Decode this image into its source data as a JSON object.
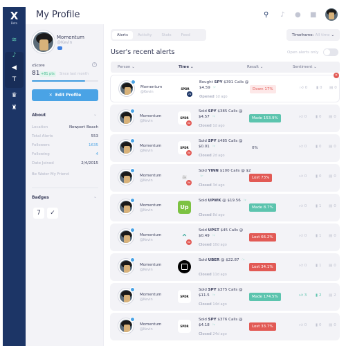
{
  "app": {
    "logo_text": "X",
    "logo_badge": "Beta"
  },
  "nav": {
    "items": [
      {
        "name": "signal-icon",
        "glyph": "≋"
      },
      {
        "name": "alerts-bell-icon",
        "glyph": "♪"
      },
      {
        "name": "megaphone-icon",
        "glyph": "◀"
      },
      {
        "name": "filter-icon",
        "glyph": "T"
      },
      {
        "name": "trophy-icon",
        "glyph": "♛"
      },
      {
        "name": "graduation-icon",
        "glyph": "♜"
      }
    ]
  },
  "page": {
    "title": "My Profile"
  },
  "profile": {
    "name": "Momentum",
    "handle": "@Kevin",
    "xscore_label": "xScore",
    "xscore_value": "81",
    "xscore_delta": "+81 pts",
    "xscore_since": "Since last month",
    "xscore_progress_percent": 80,
    "edit_button": "Edit Profile",
    "about_label": "About",
    "about": [
      {
        "key": "Location",
        "value": "Newport Beach",
        "link": false
      },
      {
        "key": "Total Alerts",
        "value": "553",
        "link": false
      },
      {
        "key": "Followers",
        "value": "1635",
        "link": true
      },
      {
        "key": "Following",
        "value": "4",
        "link": true
      },
      {
        "key": "Date Joined",
        "value": "2/4/2015",
        "link": false
      }
    ],
    "bio": "Be Water My Friend",
    "badges_label": "Badges",
    "badges": [
      "7",
      "✓"
    ]
  },
  "topbar": {
    "icons": [
      "search-icon",
      "bell-icon",
      "chat-icon",
      "discord-icon",
      "avatar"
    ]
  },
  "tabs": [
    {
      "label": "Alerts",
      "active": true
    },
    {
      "label": "Activity",
      "active": false
    },
    {
      "label": "Stats",
      "active": false
    },
    {
      "label": "Feed",
      "active": false
    }
  ],
  "timeframe": {
    "label": "Timeframe:",
    "value": "All time"
  },
  "alerts": {
    "title": "User's recent alerts",
    "open_only_label": "Open alerts only",
    "open_only_on": false,
    "columns": [
      "Person",
      "Time",
      "Result",
      "Sentiment"
    ],
    "rows": [
      {
        "name": "Momentum",
        "handle": "@Kevin",
        "logo": "SPDR",
        "logo_type": "spdr",
        "dte": "7d",
        "dte_color": "#1c3566",
        "action": "Bought",
        "ticker": "SPY",
        "rest": "$391 Calls @ $4.59",
        "status_label": "Opened",
        "status_time": "1d ago",
        "result": "Down 17%",
        "result_type": "down",
        "likes": "0",
        "bookmarks": "0",
        "comments": "0",
        "highlight": false,
        "first": true
      },
      {
        "name": "Momentum",
        "handle": "@Kevin",
        "logo": "SPDR",
        "logo_type": "spdr",
        "dte": "0d",
        "dte_color": "#e25a55",
        "action": "Sold",
        "ticker": "SPY",
        "rest": "$385 Calls @ $4.57",
        "status_label": "Closed",
        "status_time": "1d ago",
        "result": "Made 153.9%",
        "result_type": "made",
        "likes": "0",
        "bookmarks": "0",
        "comments": "0",
        "highlight": false,
        "first": false
      },
      {
        "name": "Momentum",
        "handle": "@Kevin",
        "logo": "SPDR",
        "logo_type": "spdr",
        "dte": "0d",
        "dte_color": "#e25a55",
        "action": "Sold",
        "ticker": "SPY",
        "rest": "$485 Calls @ $0.01",
        "status_label": "Closed",
        "status_time": "2d ago",
        "result": "0%",
        "result_type": "zero",
        "likes": "0",
        "bookmarks": "0",
        "comments": "0",
        "highlight": false,
        "first": false
      },
      {
        "name": "Momentum",
        "handle": "@Kevin",
        "logo": "≋",
        "logo_type": "waves",
        "dte": "0d",
        "dte_color": "#e25a55",
        "action": "Sold",
        "ticker": "YINN",
        "rest": "$100 Calls @ $2",
        "status_label": "Closed",
        "status_time": "3d ago",
        "result": "Lost 73%",
        "result_type": "lost",
        "likes": "0",
        "bookmarks": "0",
        "comments": "0",
        "highlight": false,
        "first": false
      },
      {
        "name": "Momentum",
        "handle": "@Kevin",
        "logo": "Up",
        "logo_type": "up",
        "dte": "",
        "dte_color": "",
        "action": "Sold",
        "ticker": "UPWK",
        "rest": "@ $19.56",
        "status_label": "Closed",
        "status_time": "8d ago",
        "result": "Made 8.7%",
        "result_type": "made",
        "likes": "0",
        "bookmarks": "1",
        "comments": "0",
        "highlight": false,
        "first": false
      },
      {
        "name": "Momentum",
        "handle": "@Kevin",
        "logo": "⌃",
        "logo_type": "upst",
        "dte": "0d",
        "dte_color": "#e25a55",
        "action": "Sold",
        "ticker": "UPST",
        "rest": "$45 Calls @ $0.49",
        "status_label": "Closed",
        "status_time": "10d ago",
        "result": "Lost 66.2%",
        "result_type": "lost",
        "likes": "0",
        "bookmarks": "1",
        "comments": "0",
        "highlight": false,
        "first": false
      },
      {
        "name": "Momentum",
        "handle": "@Kevin",
        "logo": "",
        "logo_type": "uber",
        "dte": "",
        "dte_color": "",
        "action": "Sold",
        "ticker": "UBER",
        "rest": "@ $22.87",
        "status_label": "Closed",
        "status_time": "11d ago",
        "result": "Lost 34.1%",
        "result_type": "lost",
        "likes": "0",
        "bookmarks": "1",
        "comments": "0",
        "highlight": false,
        "first": false
      },
      {
        "name": "Momentum",
        "handle": "@Kevin",
        "logo": "SPDR",
        "logo_type": "spdr",
        "dte": "",
        "dte_color": "",
        "action": "Sold",
        "ticker": "SPY",
        "rest": "$375 Calls @ $11.5",
        "status_label": "Closed",
        "status_time": "14d ago",
        "result": "Made 174.5%",
        "result_type": "made",
        "likes": "3",
        "bookmarks": "2",
        "comments": "2",
        "highlight": true,
        "first": false
      },
      {
        "name": "Momentum",
        "handle": "@Kevin",
        "logo": "SPDR",
        "logo_type": "spdr",
        "dte": "",
        "dte_color": "",
        "action": "Sold",
        "ticker": "SPY",
        "rest": "$376 Calls @ $4.18",
        "status_label": "Closed",
        "status_time": "24d ago",
        "result": "Lost 33.7%",
        "result_type": "lost",
        "likes": "0",
        "bookmarks": "0",
        "comments": "0",
        "highlight": false,
        "first": false
      }
    ]
  },
  "colors": {
    "nav_bg": "#1c3566",
    "accent_blue": "#4aa3e5",
    "made_green": "#5cc4ae",
    "lost_red": "#e25a55"
  }
}
